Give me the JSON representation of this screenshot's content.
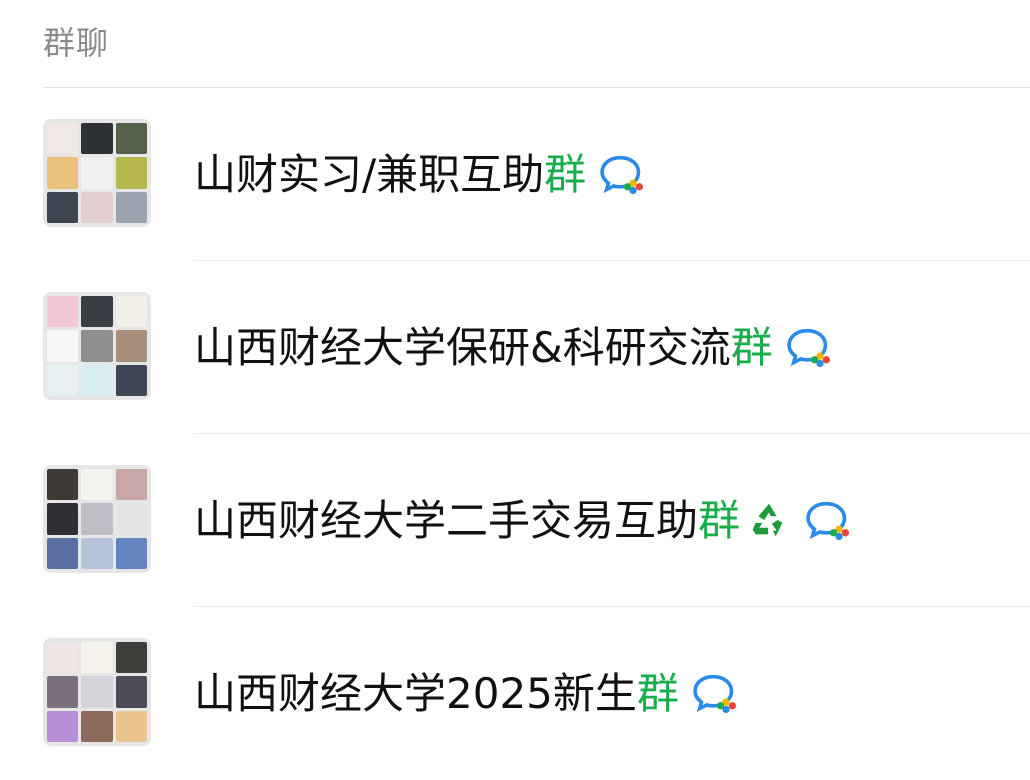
{
  "section": {
    "title": "群聊"
  },
  "groups": [
    {
      "name_main": "山财实习/兼职互助",
      "name_highlight": "群",
      "has_recycle_emoji": false,
      "badge_icon": "wecom-chat-icon",
      "avatar_tiles": [
        "#f1e9e6",
        "#2e3136",
        "#556048",
        "#e8c27a",
        "#f3f1ef",
        "#b5b84e",
        "#3d4650",
        "#e3cfd1",
        "#9aa3ad"
      ]
    },
    {
      "name_main": "山西财经大学保研&科研交流",
      "name_highlight": "群",
      "has_recycle_emoji": false,
      "badge_icon": "wecom-chat-icon",
      "avatar_tiles": [
        "#f3c8d6",
        "#3a3e44",
        "#f2efe9",
        "#f7f7f7",
        "#8d8f8f",
        "#a58f7a",
        "#e8eff3",
        "#d9eef2",
        "#3e4656"
      ]
    },
    {
      "name_main": "山西财经大学二手交易互助",
      "name_highlight": "群",
      "has_recycle_emoji": true,
      "badge_icon": "wecom-chat-icon",
      "avatar_tiles": [
        "#403a36",
        "#f5f3ee",
        "#c9a7a6",
        "#2f3034",
        "#bdbdc5",
        "#e4e4e4",
        "#5a6ea2",
        "#b7c3d8",
        "#6486c0"
      ]
    },
    {
      "name_main": "山西财经大学2025新生",
      "name_highlight": "群",
      "has_recycle_emoji": false,
      "badge_icon": "wecom-chat-icon",
      "avatar_tiles": [
        "#f0e6e6",
        "#f4f2ea",
        "#3d3f3a",
        "#7c6f7d",
        "#d7d3da",
        "#4c4a54",
        "#b58fd6",
        "#8d6a5c",
        "#e9c48e"
      ]
    }
  ],
  "colors": {
    "highlight": "#1aad4b",
    "text": "#111111",
    "header": "#8a8a8a"
  }
}
